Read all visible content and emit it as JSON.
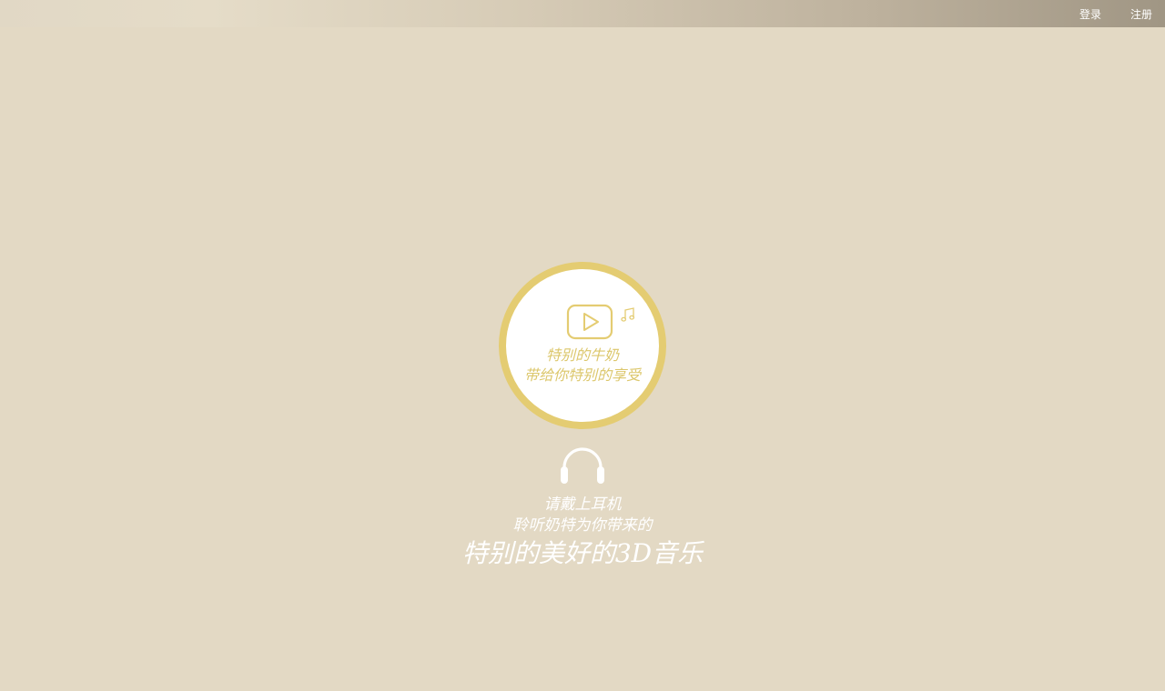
{
  "nav": {
    "login_label": "登录",
    "register_label": "注册"
  },
  "player": {
    "line1": "特别的牛奶",
    "line2": "带给你特别的享受",
    "play_icon": "play-icon",
    "note_icon": "music-note-icon"
  },
  "hint": {
    "icon": "headphones-icon",
    "line1": "请戴上耳机",
    "line2": "聆听奶特为你带来的",
    "line3": "特别的美好的3D音乐"
  },
  "colors": {
    "background": "#e3d9c4",
    "accent": "#e4cc72",
    "text_light": "#ffffff"
  }
}
